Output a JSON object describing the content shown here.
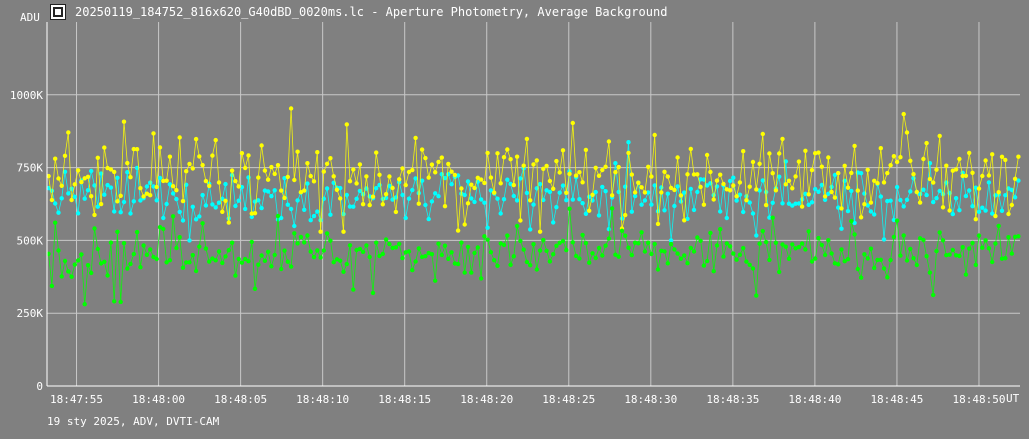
{
  "window": {
    "title": "20250119_184752_816x620_G40dBD_0020ms.lc - Aperture Photometry, Average Background",
    "icon": "lightcurve-app-icon"
  },
  "footer": "19 sty 2025, ADV, DVTI-CAM",
  "chart_data": {
    "type": "scatter",
    "title": "20250119_184752_816x620_G40dBD_0020ms.lc - Aperture Photometry, Average Background",
    "ylabel": "ADU",
    "xlabel": "UT",
    "ylim": [
      0,
      1250000
    ],
    "xlim": [
      "18:47:53.2",
      "18:48:52.5"
    ],
    "grid": true,
    "y_ticks": [
      {
        "value": 0,
        "label": "0"
      },
      {
        "value": 250000,
        "label": "250K"
      },
      {
        "value": 500000,
        "label": "500K"
      },
      {
        "value": 750000,
        "label": "750K"
      },
      {
        "value": 1000000,
        "label": "1000K"
      }
    ],
    "x_ticks": [
      "18:47:55",
      "18:48:00",
      "18:48:05",
      "18:48:10",
      "18:48:15",
      "18:48:20",
      "18:48:25",
      "18:48:30",
      "18:48:35",
      "18:48:40",
      "18:48:45",
      "18:48:50"
    ],
    "series": [
      {
        "color": "#00ffff",
        "mean": 650000,
        "spread": 100000,
        "min": 500000,
        "max": 880000
      },
      {
        "color": "#ffff00",
        "mean": 720000,
        "spread": 140000,
        "min": 530000,
        "max": 1000000
      },
      {
        "color": "#00ff00",
        "mean": 460000,
        "spread": 90000,
        "min": 235000,
        "max": 610000
      }
    ],
    "sample_interval_s": 0.02
  }
}
